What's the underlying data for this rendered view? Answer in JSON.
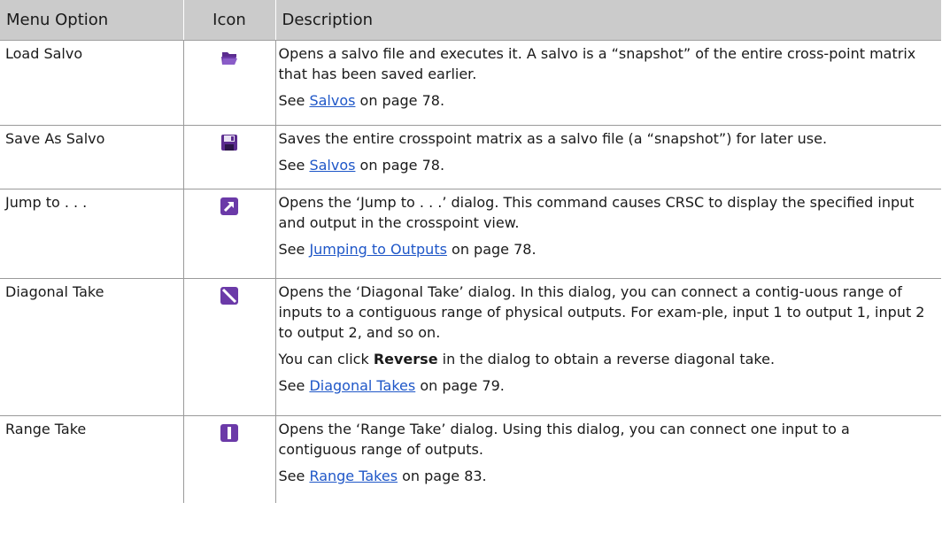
{
  "header": {
    "col_option": "Menu Option",
    "col_icon": "Icon",
    "col_desc": "Description"
  },
  "rows": [
    {
      "option": "Load Salvo",
      "icon": "open-folder-icon",
      "desc": "Opens a salvo file and executes it. A salvo is a “snapshot” of the entire cross-point matrix that has been saved earlier.",
      "see_prefix": "See ",
      "see_link": "Salvos",
      "see_suffix": " on page 78."
    },
    {
      "option": "Save As Salvo",
      "icon": "floppy-disk-icon",
      "desc": "Saves the entire crosspoint matrix as a salvo file (a “snapshot”) for later use.",
      "see_prefix": "See ",
      "see_link": "Salvos",
      "see_suffix": " on page 78."
    },
    {
      "option": "Jump to . . .",
      "icon": "jump-arrow-icon",
      "desc": "Opens the ‘Jump to . . .’ dialog. This command causes CRSC to display the specified input and output in the crosspoint view.",
      "see_prefix": "See ",
      "see_link": "Jumping to Outputs",
      "see_suffix": " on page 78."
    },
    {
      "option": "Diagonal Take",
      "icon": "diagonal-take-icon",
      "desc": "Opens the ‘Diagonal Take’ dialog. In this dialog, you can connect a contig-uous range of inputs to a contiguous range of physical outputs. For exam-ple, input 1 to output 1, input 2 to output 2, and so on.",
      "note_prefix": "You can click ",
      "note_bold": "Reverse",
      "note_suffix": " in the dialog to obtain a reverse diagonal take.",
      "see_prefix": "See ",
      "see_link": "Diagonal Takes",
      "see_suffix": " on page 79."
    },
    {
      "option": "Range Take",
      "icon": "range-take-icon",
      "desc": "Opens the ‘Range Take’ dialog. Using this dialog, you can connect one input to a contiguous range of outputs.",
      "see_prefix": "See ",
      "see_link": "Range Takes",
      "see_suffix": " on page 83."
    }
  ],
  "colors": {
    "header_bg": "#cbcbcb",
    "link": "#1f57c8",
    "icon_purple": "#6b3aa8"
  }
}
